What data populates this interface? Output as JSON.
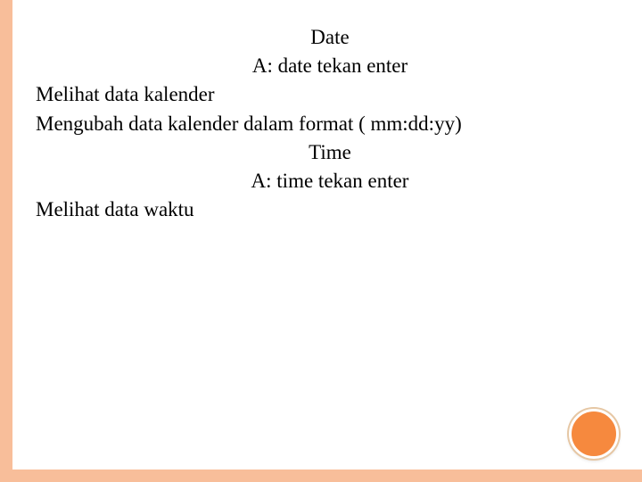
{
  "slide": {
    "lines": {
      "l1": "Date",
      "l2": "A: date  tekan enter",
      "l3": "Melihat data kalender",
      "l4": "Mengubah data kalender dalam format ( mm:dd:yy)",
      "l5": "Time",
      "l6": "A: time  tekan enter",
      "l7": "Melihat data waktu"
    }
  },
  "decor": {
    "border_color": "#f8be9a",
    "circle_color": "#f6893e"
  }
}
